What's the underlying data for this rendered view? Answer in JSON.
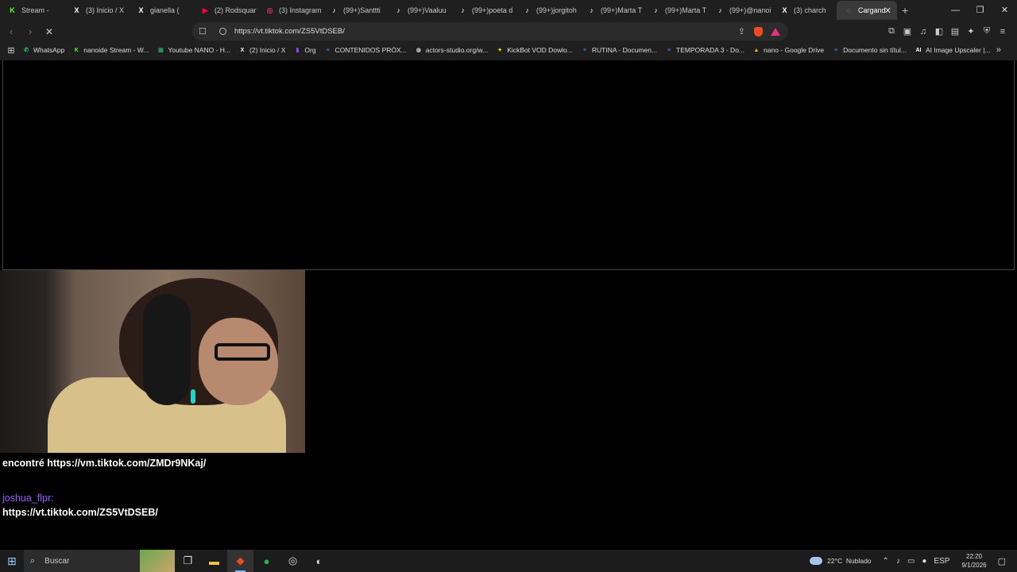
{
  "tabs": [
    {
      "label": "Stream - ",
      "icon": "kick",
      "color": "#53fc18"
    },
    {
      "label": "(3) Inicio / X",
      "icon": "x",
      "color": "#ffffff"
    },
    {
      "label": "gianella (",
      "icon": "x",
      "color": "#ffffff"
    },
    {
      "label": "(2) Rodsquar",
      "icon": "youtube",
      "color": "#ff0033"
    },
    {
      "label": "(3) Instagram",
      "icon": "instagram",
      "color": "#e1306c"
    },
    {
      "label": "(99+)Santtti",
      "icon": "tiktok",
      "color": "#ffffff"
    },
    {
      "label": "(99+)Vaaluu",
      "icon": "tiktok",
      "color": "#ffffff"
    },
    {
      "label": "(99+)poeta d",
      "icon": "tiktok",
      "color": "#ffffff"
    },
    {
      "label": "(99+)jorgitoh",
      "icon": "tiktok",
      "color": "#ffffff"
    },
    {
      "label": "(99+)Marta T",
      "icon": "tiktok",
      "color": "#ffffff"
    },
    {
      "label": "(99+)Marta T",
      "icon": "tiktok",
      "color": "#ffffff"
    },
    {
      "label": "(99+)@nanoi",
      "icon": "tiktok",
      "color": "#ffffff"
    },
    {
      "label": "(3) charch",
      "icon": "x",
      "color": "#ffffff"
    }
  ],
  "active_tab": {
    "label": "Cargand",
    "close": "✕"
  },
  "window_controls": {
    "minimize": "—",
    "restore": "❐",
    "close": "✕"
  },
  "address_bar": {
    "url": "https://vt.tiktok.com/ZS5VtDSEB/"
  },
  "bookmarks": [
    {
      "label": "WhatsApp",
      "icon": "whatsapp",
      "color": "#25d366"
    },
    {
      "label": "nanoide Stream - W...",
      "icon": "kick",
      "color": "#53fc18"
    },
    {
      "label": "Youtube NANO - H...",
      "icon": "sheets",
      "color": "#1fa463"
    },
    {
      "label": "(2) Inicio / X",
      "icon": "x",
      "color": "#ffffff"
    },
    {
      "label": "Org",
      "icon": "twitch",
      "color": "#9146ff"
    },
    {
      "label": "CONTENIDOS PRÓX...",
      "icon": "docs",
      "color": "#4285f4"
    },
    {
      "label": "actors-studio.org/w...",
      "icon": "globe",
      "color": "#cccccc"
    },
    {
      "label": "KickBot VOD Dowlo...",
      "icon": "kickbot",
      "color": "#f5d000"
    },
    {
      "label": "RUTINA - Documen...",
      "icon": "docs",
      "color": "#4285f4"
    },
    {
      "label": "TEMPORADA 3 - Do...",
      "icon": "docs",
      "color": "#4285f4"
    },
    {
      "label": "nano - Google Drive",
      "icon": "drive",
      "color": "#fbbc04"
    },
    {
      "label": "Documento sin títul...",
      "icon": "docs",
      "color": "#4285f4"
    },
    {
      "label": "AI Image Upscaler |...",
      "icon": "ai",
      "color": "#ffffff"
    }
  ],
  "chat": {
    "message1": "encontré https://vm.tiktok.com/ZMDr9NKaj/",
    "message2_user": "joshua_flpr:",
    "message2_text": "https://vt.tiktok.com/ZS5VtDSEB/"
  },
  "taskbar": {
    "search_placeholder": "Buscar",
    "weather_temp": "22°C",
    "weather_desc": "Nublado",
    "language": "ESP",
    "time": "22:20",
    "date": "9/1/2026"
  }
}
